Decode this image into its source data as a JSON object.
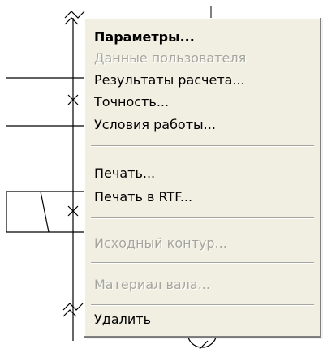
{
  "context_menu": {
    "items": [
      {
        "label": "Параметры...",
        "enabled": true,
        "bold": true
      },
      {
        "label": "Данные пользователя",
        "enabled": false
      },
      {
        "label": "Результаты расчета...",
        "enabled": true
      },
      {
        "label": "Точность...",
        "enabled": true
      },
      {
        "label": "Условия работы...",
        "enabled": true
      },
      {
        "label": "Печать...",
        "enabled": true
      },
      {
        "label": "Печать в RTF...",
        "enabled": true
      },
      {
        "label": "Исходный контур...",
        "enabled": false
      },
      {
        "label": "Материал вала...",
        "enabled": false
      },
      {
        "label": "Удалить",
        "enabled": true
      }
    ],
    "background_color": "#f1efe2",
    "disabled_text_color": "#a7a69d"
  },
  "drawing": {
    "line_color": "#000000",
    "symbol_markers": [
      "cross-mark-icon",
      "cross-mark-icon",
      "fishtail-mark-icon",
      "fishtail-mark-icon",
      "circle-hint-icon"
    ]
  }
}
